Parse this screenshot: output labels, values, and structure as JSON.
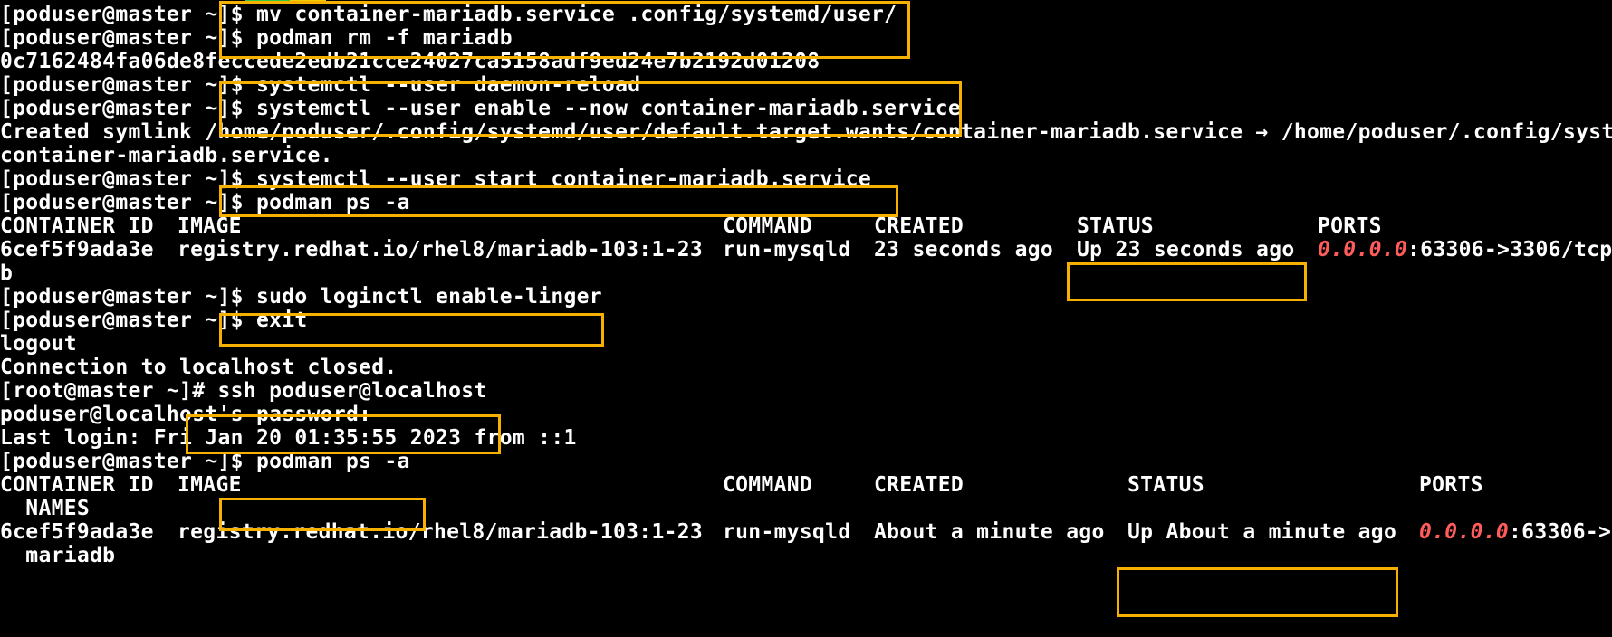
{
  "terminal": {
    "lines": [
      {
        "prompt": "[poduser@master ~]",
        "cmd": "$ mv container-mariadb.service .config/systemd/user/"
      },
      {
        "prompt": "[poduser@master ~]",
        "cmd": "$ podman rm -f mariadb"
      },
      {
        "text": "0c7162484fa06de8feccede2edb21cce24027ca5158adf9ed24e7b2192d01208"
      },
      {
        "prompt": "[poduser@master ~]",
        "cmd": "$ systemctl --user daemon-reload"
      },
      {
        "prompt": "[poduser@master ~]",
        "cmd": "$ systemctl --user enable --now container-mariadb.service"
      },
      {
        "text": "Created symlink /home/poduser/.config/systemd/user/default.target.wants/container-mariadb.service → /home/poduser/.config/syste"
      },
      {
        "text": "container-mariadb.service."
      },
      {
        "prompt": "[poduser@master ~]",
        "cmd": "$ systemctl --user start container-mariadb.service"
      },
      {
        "prompt": "[poduser@master ~]",
        "cmd": "$ podman ps -a"
      }
    ],
    "table1": {
      "header": {
        "container_id": "CONTAINER ID",
        "image": "IMAGE",
        "command": "COMMAND",
        "created": "CREATED",
        "status": "STATUS",
        "ports": "PORTS"
      },
      "row": {
        "container_id": "6cef5f9ada3e",
        "image": "registry.redhat.io/rhel8/mariadb-103:1-23",
        "command": "run-mysqld",
        "created": "23 seconds ago",
        "status": "Up 23 seconds ago",
        "ports_ip": "0.0.0.0",
        "ports_rest": ":63306->3306/tcp"
      },
      "wrap": "b"
    },
    "lines2": [
      {
        "prompt": "[poduser@master ~]",
        "cmd": "$ sudo loginctl enable-linger"
      },
      {
        "prompt": "[poduser@master ~]",
        "cmd": "$ exit"
      },
      {
        "text": "logout"
      },
      {
        "text": "Connection to localhost closed."
      },
      {
        "prompt": "[root@master ~]",
        "cmd": "# ssh poduser@localhost"
      },
      {
        "text": "poduser@localhost's password:"
      },
      {
        "text": "Last login: Fri Jan 20 01:35:55 2023 from ::1"
      },
      {
        "prompt": "[poduser@master ~]",
        "cmd": "$ podman ps -a"
      }
    ],
    "table2": {
      "header": {
        "container_id": "CONTAINER ID",
        "image": "IMAGE",
        "command": "COMMAND",
        "created": "CREATED",
        "status": "STATUS",
        "ports": "PORTS"
      },
      "header_wrap": "  NAMES",
      "row": {
        "container_id": "6cef5f9ada3e",
        "image": "registry.redhat.io/rhel8/mariadb-103:1-23",
        "command": "run-mysqld",
        "created": "About a minute ago",
        "status": "Up About a minute ago",
        "ports_ip": "0.0.0.0",
        "ports_rest": ":63306->"
      },
      "row_wrap": "  mariadb"
    }
  },
  "colors": {
    "background": "#000000",
    "text": "#ffffff",
    "highlight_box": "#f5b000",
    "ip_address": "#ff5c5c"
  }
}
